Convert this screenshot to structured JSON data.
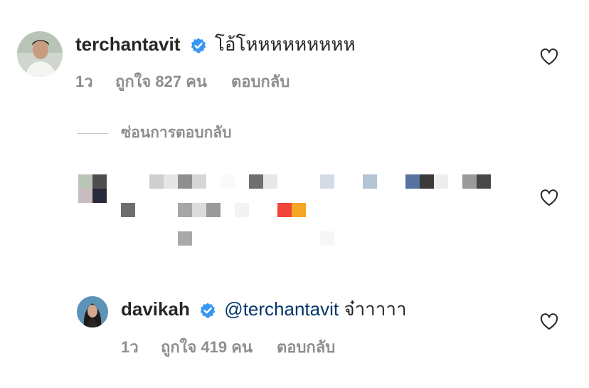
{
  "comments": [
    {
      "username": "terchantavit",
      "text": "โอ้โหหหหหหหหห",
      "time": "1ว",
      "likes": "ถูกใจ 827 คน",
      "reply": "ตอบกลับ"
    },
    {
      "username": "davikah",
      "mention": "@terchantavit",
      "text": "จ๋าาาาา",
      "time": "1ว",
      "likes": "ถูกใจ 419 คน",
      "reply": "ตอบกลับ"
    }
  ],
  "hide_replies": "ซ่อนการตอบกลับ",
  "icons": [
    "verified-badge-icon",
    "heart-icon"
  ],
  "colors": {
    "verified": "#3897f0",
    "meta": "#8e8e8e",
    "mention": "#00376b"
  }
}
